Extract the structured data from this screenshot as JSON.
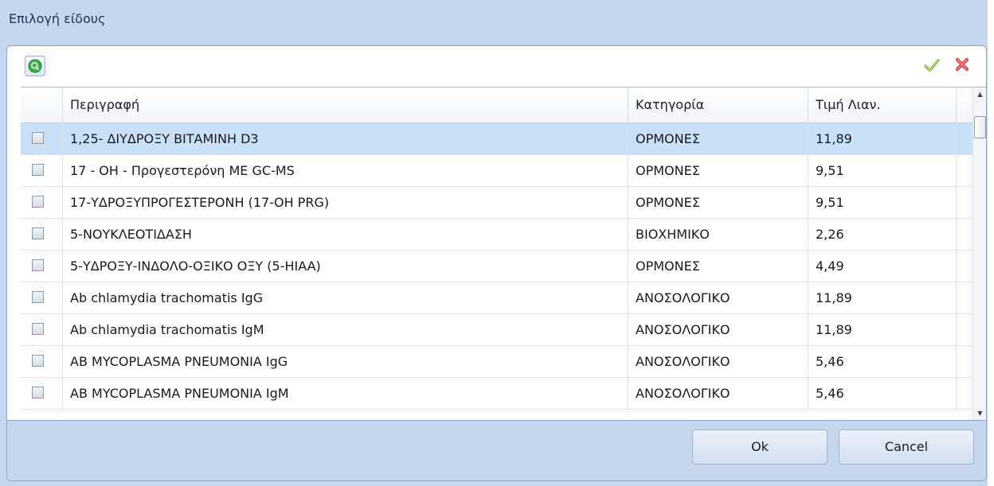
{
  "dialog": {
    "title": "Επιλογή είδους"
  },
  "toolbar": {
    "search_icon": "search-icon",
    "confirm_icon": "checkmark-icon",
    "cancel_icon": "close-icon"
  },
  "grid": {
    "columns": [
      "Περιγραφή",
      "Κατηγορία",
      "Τιμή Λιαν."
    ],
    "rows": [
      {
        "desc": "1,25- ΔΙΥΔΡΟΞΥ ΒΙΤΑΜΙΝΗ D3",
        "cat": "ΟΡΜΟΝΕΣ",
        "price": "11,89",
        "selected": true
      },
      {
        "desc": "17 - OH - Προγεστερόνη  ΜΕ GC-MS",
        "cat": "ΟΡΜΟΝΕΣ",
        "price": "9,51"
      },
      {
        "desc": "17-ΥΔΡΟΞΥΠΡΟΓΕΣΤΕΡΟΝΗ (17-OH PRG)",
        "cat": "ΟΡΜΟΝΕΣ",
        "price": "9,51"
      },
      {
        "desc": "5-ΝΟΥΚΛΕΟΤΙΔΑΣΗ",
        "cat": "ΒΙΟΧΗΜΙΚΟ",
        "price": "2,26"
      },
      {
        "desc": "5-ΥΔΡΟΞΥ-ΙΝΔΟΛΟ-ΟΞΙΚΟ ΟΞΥ (5-HIAA)",
        "cat": "ΟΡΜΟΝΕΣ",
        "price": "4,49"
      },
      {
        "desc": "Ab chlamydia trachomatis IgG",
        "cat": "ΑΝΟΣΟΛΟΓΙΚΟ",
        "price": "11,89"
      },
      {
        "desc": "Ab chlamydia trachomatis IgM",
        "cat": "ΑΝΟΣΟΛΟΓΙΚΟ",
        "price": "11,89"
      },
      {
        "desc": "AB MYCOPLASMA PNEUMONIA IgG",
        "cat": "ΑΝΟΣΟΛΟΓΙΚΟ",
        "price": "5,46"
      },
      {
        "desc": "AB MYCOPLASMA PNEUMONIA IgM",
        "cat": "ΑΝΟΣΟΛΟΓΙΚΟ",
        "price": "5,46"
      }
    ]
  },
  "footer": {
    "ok_label": "Ok",
    "cancel_label": "Cancel"
  },
  "colors": {
    "frame": "#c6d6ec",
    "selected_row": "#c9e0f7"
  }
}
